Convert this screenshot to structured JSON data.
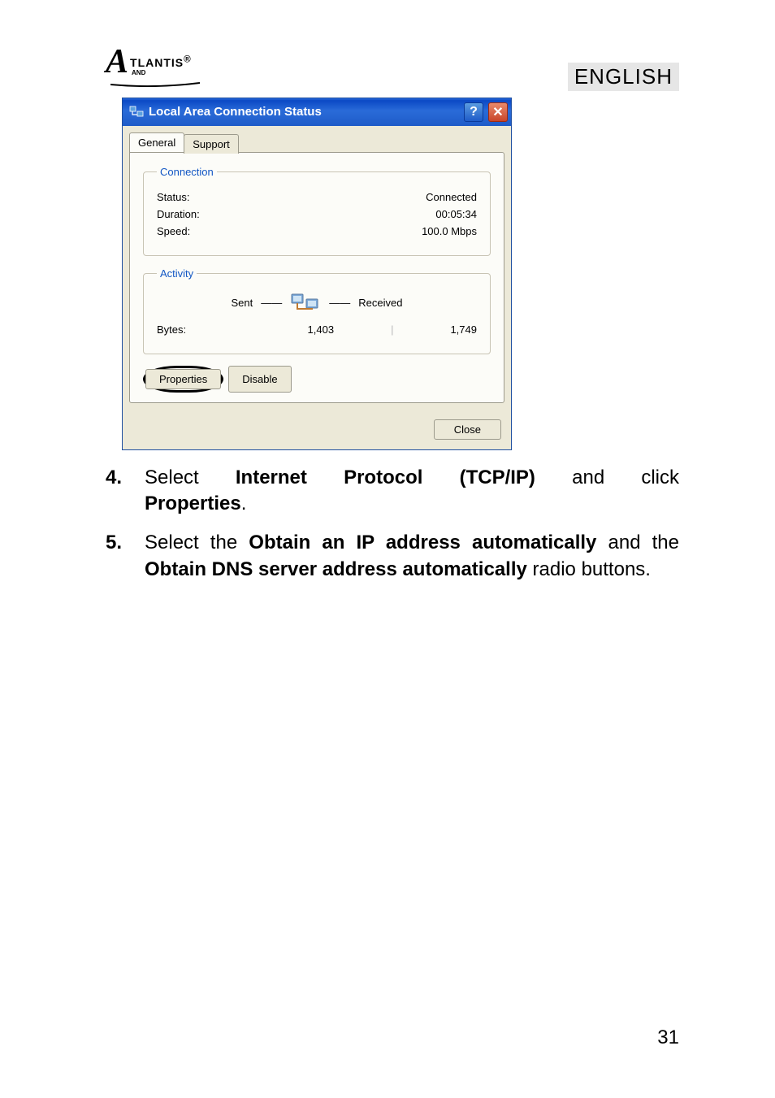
{
  "header": {
    "logo_main": "A",
    "logo_text": "TLANTIS",
    "logo_sub": "AND",
    "logo_reg": "®",
    "language_badge": "ENGLISH"
  },
  "dialog": {
    "title": "Local Area Connection Status",
    "tabs": {
      "general": "General",
      "support": "Support"
    },
    "connection": {
      "legend": "Connection",
      "status_label": "Status:",
      "status_value": "Connected",
      "duration_label": "Duration:",
      "duration_value": "00:05:34",
      "speed_label": "Speed:",
      "speed_value": "100.0 Mbps"
    },
    "activity": {
      "legend": "Activity",
      "sent_label": "Sent",
      "received_label": "Received",
      "bytes_label": "Bytes:",
      "bytes_sent": "1,403",
      "bytes_received": "1,749"
    },
    "buttons": {
      "properties": "Properties",
      "disable": "Disable",
      "close": "Close"
    }
  },
  "instructions": {
    "item4_num": "4.",
    "item4_p1": "Select ",
    "item4_b1": "Internet Protocol (TCP/IP)",
    "item4_p2": " and click ",
    "item4_b2": "Properties",
    "item4_p3": ".",
    "item5_num": "5.",
    "item5_p1": "Select the ",
    "item5_b1": "Obtain an IP address automatically",
    "item5_p2": " and the ",
    "item5_b2": "Obtain DNS server address automatically",
    "item5_p3": " radio buttons."
  },
  "page_number": "31"
}
